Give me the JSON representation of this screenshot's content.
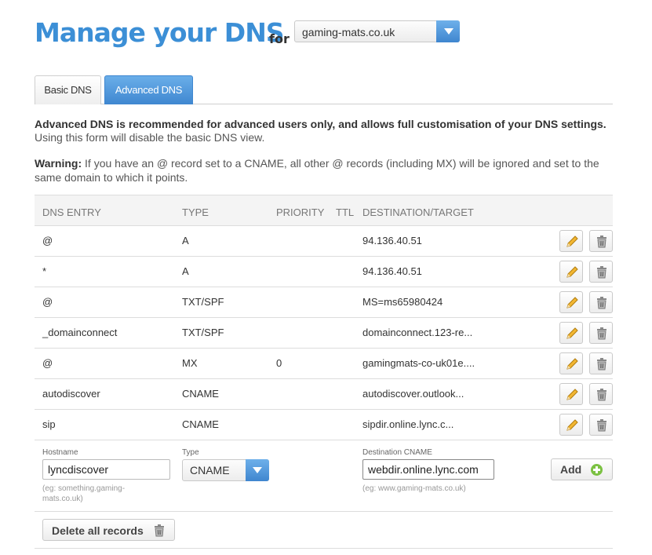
{
  "header": {
    "title": "Manage your DNS",
    "for_label": "for",
    "domain_selected": "gaming-mats.co.uk"
  },
  "tabs": [
    {
      "label": "Basic DNS",
      "active": false
    },
    {
      "label": "Advanced DNS",
      "active": true
    }
  ],
  "intro": {
    "bold_text": "Advanced DNS is recommended for advanced users only, and allows full customisation of your DNS settings.",
    "sub_text": "Using this form will disable the basic DNS view."
  },
  "warning": {
    "label": "Warning:",
    "text": " If you have an @ record set to a CNAME, all other @ records (including MX) will be ignored and set to the same domain to which it points."
  },
  "table": {
    "headers": {
      "entry": "DNS ENTRY",
      "type": "TYPE",
      "priority": "PRIORITY",
      "ttl": "TTL",
      "destination": "DESTINATION/TARGET"
    },
    "rows": [
      {
        "entry": "@",
        "type": "A",
        "priority": "",
        "ttl": "",
        "destination": "94.136.40.51"
      },
      {
        "entry": "*",
        "type": "A",
        "priority": "",
        "ttl": "",
        "destination": "94.136.40.51"
      },
      {
        "entry": "@",
        "type": "TXT/SPF",
        "priority": "",
        "ttl": "",
        "destination": "MS=ms65980424"
      },
      {
        "entry": "_domainconnect",
        "type": "TXT/SPF",
        "priority": "",
        "ttl": "",
        "destination": "domainconnect.123-re..."
      },
      {
        "entry": "@",
        "type": "MX",
        "priority": "0",
        "ttl": "",
        "destination": "gamingmats-co-uk01e...."
      },
      {
        "entry": "autodiscover",
        "type": "CNAME",
        "priority": "",
        "ttl": "",
        "destination": "autodiscover.outlook..."
      },
      {
        "entry": "sip",
        "type": "CNAME",
        "priority": "",
        "ttl": "",
        "destination": "sipdir.online.lync.c..."
      }
    ]
  },
  "add_form": {
    "hostname_label": "Hostname",
    "hostname_value": "lyncdiscover",
    "hostname_hint": "(eg: something.gaming-mats.co.uk)",
    "type_label": "Type",
    "type_value": "CNAME",
    "dest_label": "Destination CNAME",
    "dest_value": "webdir.online.lync.com",
    "dest_hint": "(eg: www.gaming-mats.co.uk)",
    "add_label": "Add"
  },
  "footer": {
    "delete_all_label": "Delete all records"
  },
  "colors": {
    "brand_blue": "#3c8fd6",
    "add_green": "#7bc142"
  }
}
